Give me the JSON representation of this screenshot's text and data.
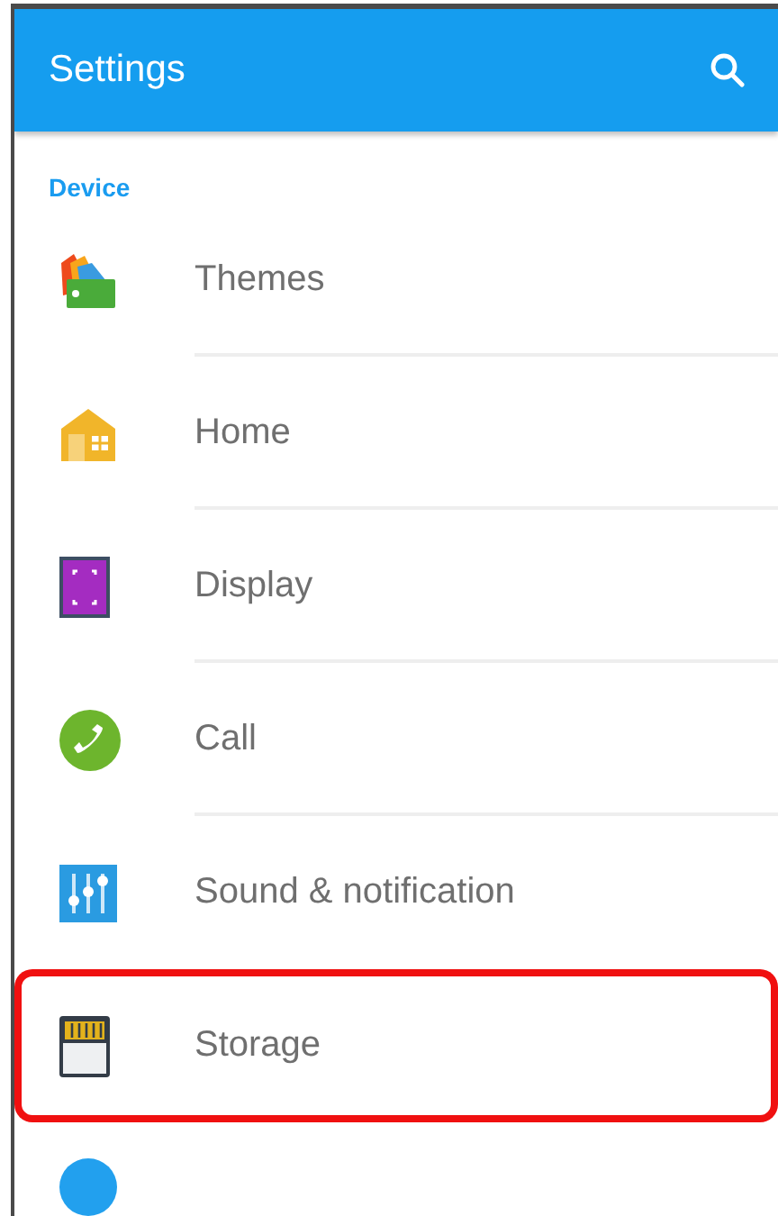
{
  "app_bar": {
    "title": "Settings"
  },
  "section": {
    "title": "Device"
  },
  "items": [
    {
      "label": "Themes",
      "selected": false
    },
    {
      "label": "Home",
      "selected": false
    },
    {
      "label": "Display",
      "selected": false
    },
    {
      "label": "Call",
      "selected": false
    },
    {
      "label": "Sound & notification",
      "selected": false
    },
    {
      "label": "Storage",
      "selected": true
    }
  ]
}
